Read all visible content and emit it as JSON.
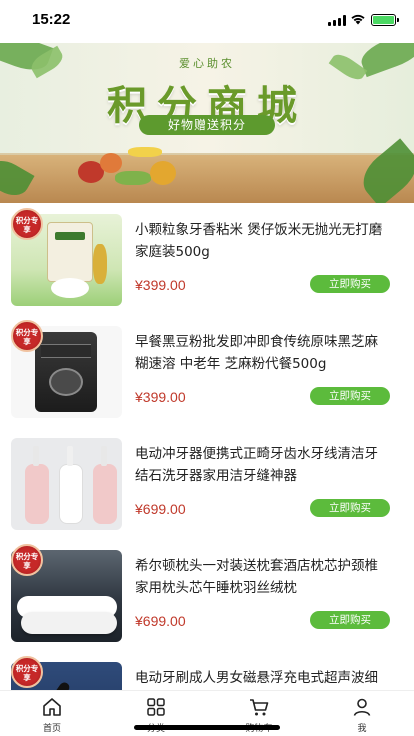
{
  "status_bar": {
    "time": "15:22",
    "battery_color": "#4cd964"
  },
  "banner": {
    "top_text": "爱心助农",
    "title": "积分商城",
    "subtitle": "好物赠送积分"
  },
  "badge_text": "积分专享",
  "buy_label": "立即购买",
  "products": [
    {
      "title": "小颗粒象牙香粘米 煲仔饭米无抛光无打磨家庭装500g",
      "price": "¥399.00"
    },
    {
      "title": "早餐黑豆粉批发即冲即食传统原味黑芝麻糊速溶 中老年 芝麻粉代餐500g",
      "price": "¥399.00"
    },
    {
      "title": "电动冲牙器便携式正畸牙齿水牙线清洁牙结石洗牙器家用洁牙缝神器",
      "price": "¥699.00"
    },
    {
      "title": "希尔顿枕头一对装送枕套酒店枕芯护颈椎家用枕头芯午睡枕羽丝绒枕",
      "price": "¥699.00"
    },
    {
      "title": "电动牙刷成人男女磁悬浮充电式超声波细软毛美白防水情侣",
      "price": ""
    }
  ],
  "tabs": [
    {
      "label": "首页",
      "icon": "home-icon"
    },
    {
      "label": "分类",
      "icon": "grid-icon"
    },
    {
      "label": "购物车",
      "icon": "cart-icon"
    },
    {
      "label": "我",
      "icon": "user-icon"
    }
  ],
  "colors": {
    "accent_green": "#5cbb3c",
    "price_red": "#c0392b",
    "badge_red": "#c62828"
  }
}
